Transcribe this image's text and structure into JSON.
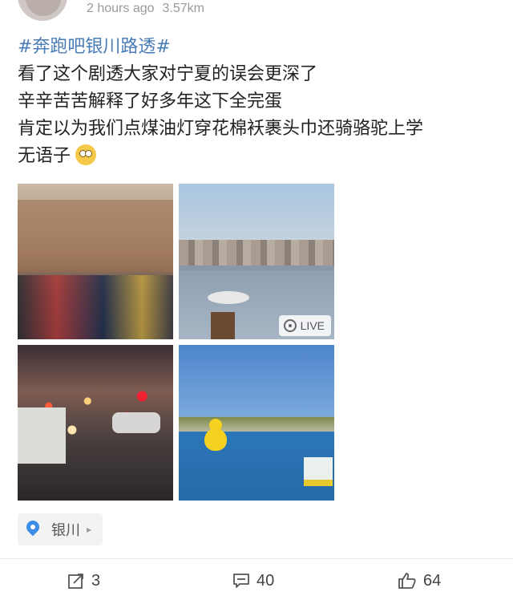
{
  "post": {
    "meta": {
      "time": "2 hours ago",
      "distance": "3.57km"
    },
    "hashtag": "#奔跑吧银川路透#",
    "lines": [
      "看了这个剧透大家对宁夏的误会更深了",
      "辛辛苦苦解释了好多年这下全完蛋",
      "肯定以为我们点煤油灯穿花棉袄裹头巾还骑骆驼上学",
      "无语子"
    ],
    "emoji_icon": "flushed-face-emoji"
  },
  "images": [
    {
      "name": "filming-crew-photo"
    },
    {
      "name": "seagull-lake-photo",
      "badge": "LIVE",
      "badge_icon": "live-photo-icon"
    },
    {
      "name": "rainy-traffic-photo"
    },
    {
      "name": "rubber-duck-lake-photo"
    }
  ],
  "location": {
    "label": "银川",
    "icon": "location-pin-icon",
    "caret": "▸",
    "color": "#3d8ce8"
  },
  "actions": {
    "share": {
      "count": "3",
      "icon": "share-icon"
    },
    "comment": {
      "count": "40",
      "icon": "comment-icon"
    },
    "like": {
      "count": "64",
      "icon": "thumbs-up-icon"
    }
  },
  "colors": {
    "hashtag": "#4a7db8",
    "meta_text": "#9a9a9a"
  }
}
